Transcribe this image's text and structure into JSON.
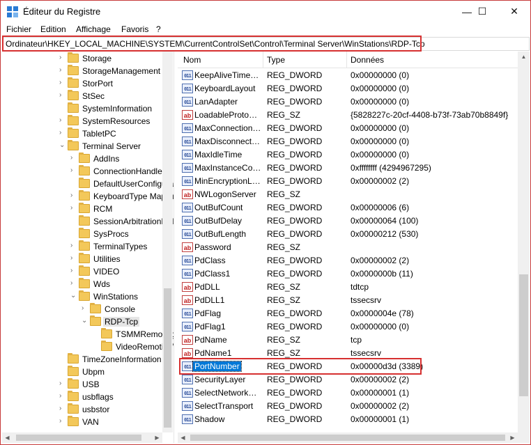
{
  "window": {
    "title": "Éditeur du Registre",
    "min_glyph": "—",
    "max_glyph": "☐",
    "close_glyph": "✕",
    "app_icon": "regedit-icon"
  },
  "menu": [
    "Fichier",
    "Edition",
    "Affichage",
    "Favoris",
    "?"
  ],
  "address": {
    "path": "Ordinateur\\HKEY_LOCAL_MACHINE\\SYSTEM\\CurrentControlSet\\Control\\Terminal Server\\WinStations\\RDP-Tcp"
  },
  "tree": [
    {
      "label": "Storage",
      "level": 0,
      "expander": ">"
    },
    {
      "label": "StorageManagement",
      "level": 0,
      "expander": ">"
    },
    {
      "label": "StorPort",
      "level": 0,
      "expander": ">"
    },
    {
      "label": "StSec",
      "level": 0,
      "expander": ">"
    },
    {
      "label": "SystemInformation",
      "level": 0,
      "expander": ""
    },
    {
      "label": "SystemResources",
      "level": 0,
      "expander": ">"
    },
    {
      "label": "TabletPC",
      "level": 0,
      "expander": ">"
    },
    {
      "label": "Terminal Server",
      "level": 0,
      "expander": "v"
    },
    {
      "label": "AddIns",
      "level": 1,
      "expander": ">"
    },
    {
      "label": "ConnectionHandler",
      "level": 1,
      "expander": ">"
    },
    {
      "label": "DefaultUserConfiguration",
      "level": 1,
      "expander": ""
    },
    {
      "label": "KeyboardType Mapping",
      "level": 1,
      "expander": ">"
    },
    {
      "label": "RCM",
      "level": 1,
      "expander": ">"
    },
    {
      "label": "SessionArbitrationHelper",
      "level": 1,
      "expander": ""
    },
    {
      "label": "SysProcs",
      "level": 1,
      "expander": ""
    },
    {
      "label": "TerminalTypes",
      "level": 1,
      "expander": ">"
    },
    {
      "label": "Utilities",
      "level": 1,
      "expander": ">"
    },
    {
      "label": "VIDEO",
      "level": 1,
      "expander": ">"
    },
    {
      "label": "Wds",
      "level": 1,
      "expander": ">"
    },
    {
      "label": "WinStations",
      "level": 1,
      "expander": "v"
    },
    {
      "label": "Console",
      "level": 2,
      "expander": ">"
    },
    {
      "label": "RDP-Tcp",
      "level": 2,
      "expander": "v",
      "selected": true
    },
    {
      "label": "TSMMRemotingAllowedApps",
      "level": 3,
      "expander": ""
    },
    {
      "label": "VideoRemotingWindowNames",
      "level": 3,
      "expander": ""
    },
    {
      "label": "TimeZoneInformation",
      "level": 0,
      "expander": ""
    },
    {
      "label": "Ubpm",
      "level": 0,
      "expander": ""
    },
    {
      "label": "USB",
      "level": 0,
      "expander": ">"
    },
    {
      "label": "usbflags",
      "level": 0,
      "expander": ">"
    },
    {
      "label": "usbstor",
      "level": 0,
      "expander": ">"
    },
    {
      "label": "VAN",
      "level": 0,
      "expander": ">"
    }
  ],
  "columns": {
    "name": "Nom",
    "type": "Type",
    "data": "Données"
  },
  "values": [
    {
      "name": "KeepAliveTimeout",
      "type": "REG_DWORD",
      "data": "0x00000000 (0)",
      "icon": "dword"
    },
    {
      "name": "KeyboardLayout",
      "type": "REG_DWORD",
      "data": "0x00000000 (0)",
      "icon": "dword"
    },
    {
      "name": "LanAdapter",
      "type": "REG_DWORD",
      "data": "0x00000000 (0)",
      "icon": "dword"
    },
    {
      "name": "LoadableProtocol_Object",
      "type": "REG_SZ",
      "data": "{5828227c-20cf-4408-b73f-73ab70b8849f}",
      "icon": "sz"
    },
    {
      "name": "MaxConnectionTime",
      "type": "REG_DWORD",
      "data": "0x00000000 (0)",
      "icon": "dword"
    },
    {
      "name": "MaxDisconnectionTime",
      "type": "REG_DWORD",
      "data": "0x00000000 (0)",
      "icon": "dword"
    },
    {
      "name": "MaxIdleTime",
      "type": "REG_DWORD",
      "data": "0x00000000 (0)",
      "icon": "dword"
    },
    {
      "name": "MaxInstanceCount",
      "type": "REG_DWORD",
      "data": "0xffffffff (4294967295)",
      "icon": "dword"
    },
    {
      "name": "MinEncryptionLevel",
      "type": "REG_DWORD",
      "data": "0x00000002 (2)",
      "icon": "dword"
    },
    {
      "name": "NWLogonServer",
      "type": "REG_SZ",
      "data": "",
      "icon": "sz"
    },
    {
      "name": "OutBufCount",
      "type": "REG_DWORD",
      "data": "0x00000006 (6)",
      "icon": "dword"
    },
    {
      "name": "OutBufDelay",
      "type": "REG_DWORD",
      "data": "0x00000064 (100)",
      "icon": "dword"
    },
    {
      "name": "OutBufLength",
      "type": "REG_DWORD",
      "data": "0x00000212 (530)",
      "icon": "dword"
    },
    {
      "name": "Password",
      "type": "REG_SZ",
      "data": "",
      "icon": "sz"
    },
    {
      "name": "PdClass",
      "type": "REG_DWORD",
      "data": "0x00000002 (2)",
      "icon": "dword"
    },
    {
      "name": "PdClass1",
      "type": "REG_DWORD",
      "data": "0x0000000b (11)",
      "icon": "dword"
    },
    {
      "name": "PdDLL",
      "type": "REG_SZ",
      "data": "tdtcp",
      "icon": "sz"
    },
    {
      "name": "PdDLL1",
      "type": "REG_SZ",
      "data": "tssecsrv",
      "icon": "sz"
    },
    {
      "name": "PdFlag",
      "type": "REG_DWORD",
      "data": "0x0000004e (78)",
      "icon": "dword"
    },
    {
      "name": "PdFlag1",
      "type": "REG_DWORD",
      "data": "0x00000000 (0)",
      "icon": "dword"
    },
    {
      "name": "PdName",
      "type": "REG_SZ",
      "data": "tcp",
      "icon": "sz"
    },
    {
      "name": "PdName1",
      "type": "REG_SZ",
      "data": "tssecsrv",
      "icon": "sz"
    },
    {
      "name": "PortNumber",
      "type": "REG_DWORD",
      "data": "0x00000d3d (3389)",
      "icon": "dword",
      "selected": true
    },
    {
      "name": "SecurityLayer",
      "type": "REG_DWORD",
      "data": "0x00000002 (2)",
      "icon": "dword"
    },
    {
      "name": "SelectNetworkDetect",
      "type": "REG_DWORD",
      "data": "0x00000001 (1)",
      "icon": "dword"
    },
    {
      "name": "SelectTransport",
      "type": "REG_DWORD",
      "data": "0x00000002 (2)",
      "icon": "dword"
    },
    {
      "name": "Shadow",
      "type": "REG_DWORD",
      "data": "0x00000001 (1)",
      "icon": "dword"
    }
  ],
  "icon_glyphs": {
    "dword": "011",
    "sz": "ab"
  },
  "colors": {
    "highlight_border": "#d63030",
    "selection": "#0078d7",
    "folder": "#f3c85a"
  }
}
